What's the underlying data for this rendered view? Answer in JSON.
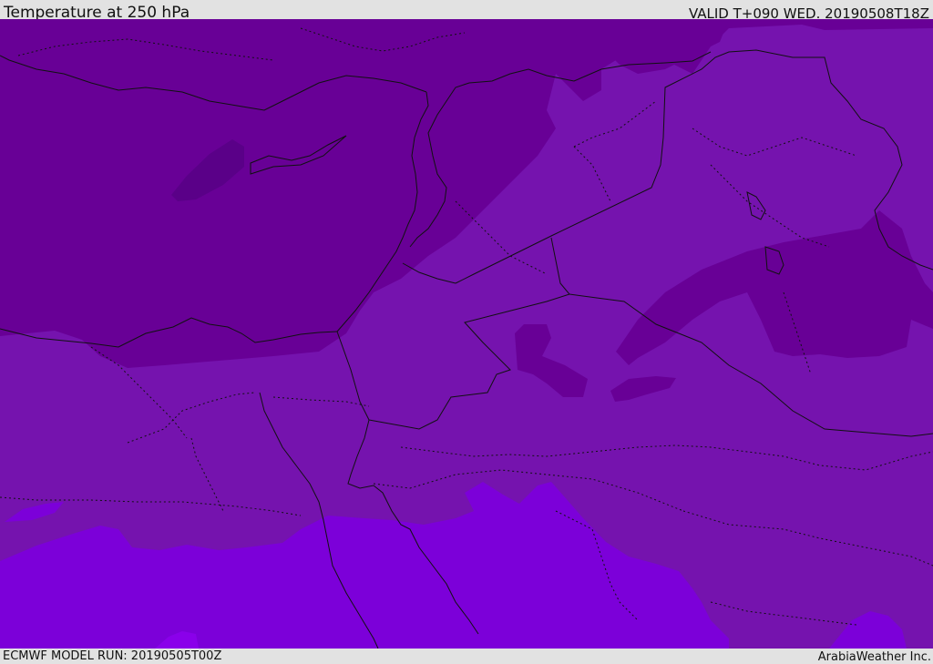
{
  "header": {
    "title": "Temperature at 250 hPa",
    "valid": "VALID T+090 WED. 20190508T18Z"
  },
  "footer": {
    "model_run": "ECMWF MODEL RUN: 20190505T00Z",
    "credit": "ArabiaWeather Inc."
  },
  "map": {
    "field": "temperature",
    "level": "250 hPa",
    "colors": {
      "darkest": "#5a0088",
      "dark": "#680096",
      "medium": "#7513ae",
      "light": "#7c00d9",
      "lightest": "#8a00ea",
      "border": "#111111"
    }
  }
}
